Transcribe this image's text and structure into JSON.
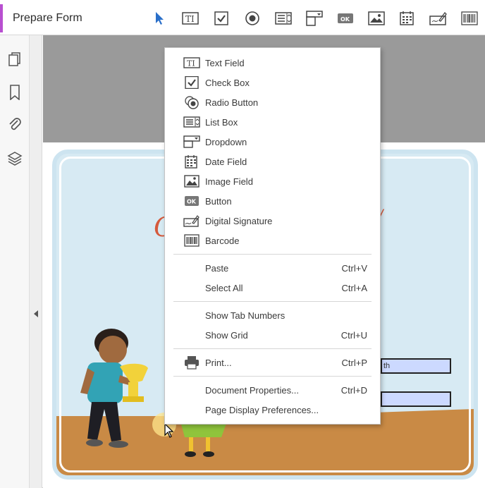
{
  "toolbar": {
    "title": "Prepare Form",
    "accent_color": "#b84fd0",
    "tools": [
      {
        "name": "select-pointer-icon"
      },
      {
        "name": "text-field-icon"
      },
      {
        "name": "check-box-icon"
      },
      {
        "name": "radio-button-icon"
      },
      {
        "name": "list-box-icon"
      },
      {
        "name": "dropdown-icon"
      },
      {
        "name": "button-icon",
        "glyph": "OK"
      },
      {
        "name": "image-field-icon"
      },
      {
        "name": "date-field-icon"
      },
      {
        "name": "digital-signature-icon"
      },
      {
        "name": "barcode-icon"
      }
    ]
  },
  "sidebar": {
    "items": [
      {
        "name": "pages-icon"
      },
      {
        "name": "bookmark-icon"
      },
      {
        "name": "attachment-icon"
      },
      {
        "name": "layers-icon"
      }
    ]
  },
  "context_menu": {
    "groups": [
      [
        {
          "label": "Text Field",
          "icon": "text-field-icon",
          "shortcut": ""
        },
        {
          "label": "Check Box",
          "icon": "check-box-icon",
          "shortcut": ""
        },
        {
          "label": "Radio Button",
          "icon": "radio-button-icon",
          "shortcut": ""
        },
        {
          "label": "List Box",
          "icon": "list-box-icon",
          "shortcut": ""
        },
        {
          "label": "Dropdown",
          "icon": "dropdown-icon",
          "shortcut": ""
        },
        {
          "label": "Date Field",
          "icon": "date-field-icon",
          "shortcut": ""
        },
        {
          "label": "Image Field",
          "icon": "image-field-icon",
          "shortcut": ""
        },
        {
          "label": "Button",
          "icon": "button-icon",
          "shortcut": ""
        },
        {
          "label": "Digital Signature",
          "icon": "digital-signature-icon",
          "shortcut": ""
        },
        {
          "label": "Barcode",
          "icon": "barcode-icon",
          "shortcut": ""
        }
      ],
      [
        {
          "label": "Paste",
          "shortcut": "Ctrl+V"
        },
        {
          "label": "Select All",
          "shortcut": "Ctrl+A"
        }
      ],
      [
        {
          "label": "Show Tab Numbers",
          "shortcut": ""
        },
        {
          "label": "Show Grid",
          "shortcut": "Ctrl+U"
        }
      ],
      [
        {
          "label": "Print...",
          "icon": "printer-icon",
          "shortcut": "Ctrl+P"
        }
      ],
      [
        {
          "label": "Document Properties...",
          "shortcut": "Ctrl+D"
        },
        {
          "label": "Page Display Preferences...",
          "shortcut": ""
        }
      ]
    ]
  },
  "document": {
    "field_partial_text": "th",
    "field_fill_color": "#ccd9ff"
  }
}
